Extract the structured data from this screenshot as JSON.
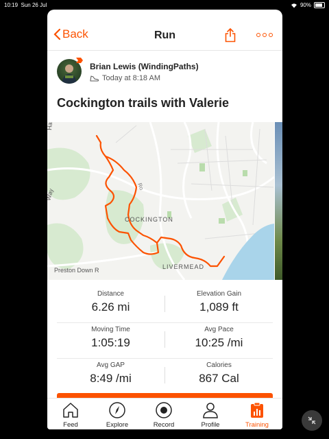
{
  "status": {
    "time": "10:19",
    "date": "Sun 26 Jul",
    "battery": "90%"
  },
  "nav": {
    "back_label": "Back",
    "title": "Run"
  },
  "athlete": {
    "name": "Brian Lewis (WindingPaths)",
    "time": "Today at 8:18 AM"
  },
  "activity": {
    "title": "Cockington trails with Valerie"
  },
  "map": {
    "labels": [
      "COCKINGTON",
      "LIVERMEAD",
      "Preston Down R",
      "Way",
      "Ha",
      "Ro"
    ],
    "route_color": "#fc5200"
  },
  "stats": [
    {
      "label": "Distance",
      "value": "6.26 mi"
    },
    {
      "label": "Elevation Gain",
      "value": "1,089 ft"
    },
    {
      "label": "Moving Time",
      "value": "1:05:19"
    },
    {
      "label": "Avg Pace",
      "value": "10:25 /mi"
    },
    {
      "label": "Avg GAP",
      "value": "8:49 /mi"
    },
    {
      "label": "Calories",
      "value": "867 Cal"
    }
  ],
  "tabs": [
    {
      "label": "Feed",
      "icon": "home-icon"
    },
    {
      "label": "Explore",
      "icon": "compass-icon"
    },
    {
      "label": "Record",
      "icon": "record-icon"
    },
    {
      "label": "Profile",
      "icon": "person-icon"
    },
    {
      "label": "Training",
      "icon": "calendar-chart-icon",
      "active": true
    }
  ],
  "colors": {
    "accent": "#fc5200",
    "water": "#a9d4ea",
    "park": "#cfe6c4"
  }
}
